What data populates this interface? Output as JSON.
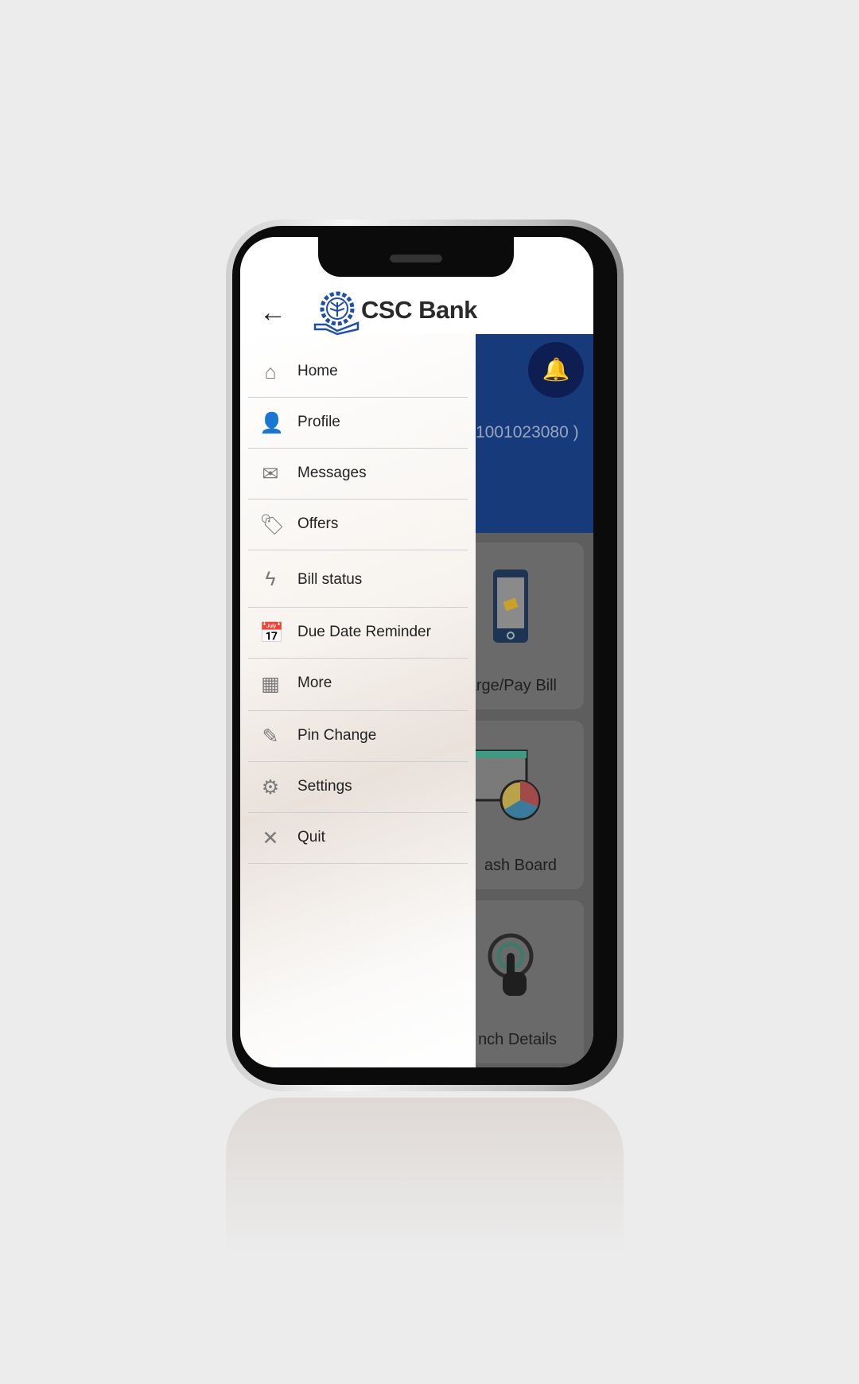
{
  "header": {
    "title": "CSC Bank",
    "back_icon": "arrow-left-icon",
    "logo": "CSC Bank logo"
  },
  "background": {
    "account_fragment": "1001023080 )",
    "cards": [
      {
        "label": "arge/Pay Bill",
        "icon": "mobile-card-icon"
      },
      {
        "label": "ash Board",
        "icon": "dashboard-chart-icon"
      },
      {
        "label": "nch Details",
        "icon": "touch-icon"
      }
    ],
    "notification_icon": "bell-plus-icon"
  },
  "menu": [
    {
      "label": "Home",
      "icon": "home-icon"
    },
    {
      "label": "Profile",
      "icon": "person-icon"
    },
    {
      "label": "Messages",
      "icon": "mail-icon"
    },
    {
      "label": "Offers",
      "icon": "tag-icon"
    },
    {
      "label": "Bill status",
      "icon": "lightning-icon"
    },
    {
      "label": "Due Date Reminder",
      "icon": "calendar-icon"
    },
    {
      "label": "More",
      "icon": "dashboard-icon"
    },
    {
      "label": "Pin Change",
      "icon": "pencil-icon"
    },
    {
      "label": "Settings",
      "icon": "gear-icon"
    },
    {
      "label": "Quit",
      "icon": "close-icon"
    }
  ],
  "colors": {
    "brand": "#1f4fa8",
    "banner": "#173a7a"
  }
}
